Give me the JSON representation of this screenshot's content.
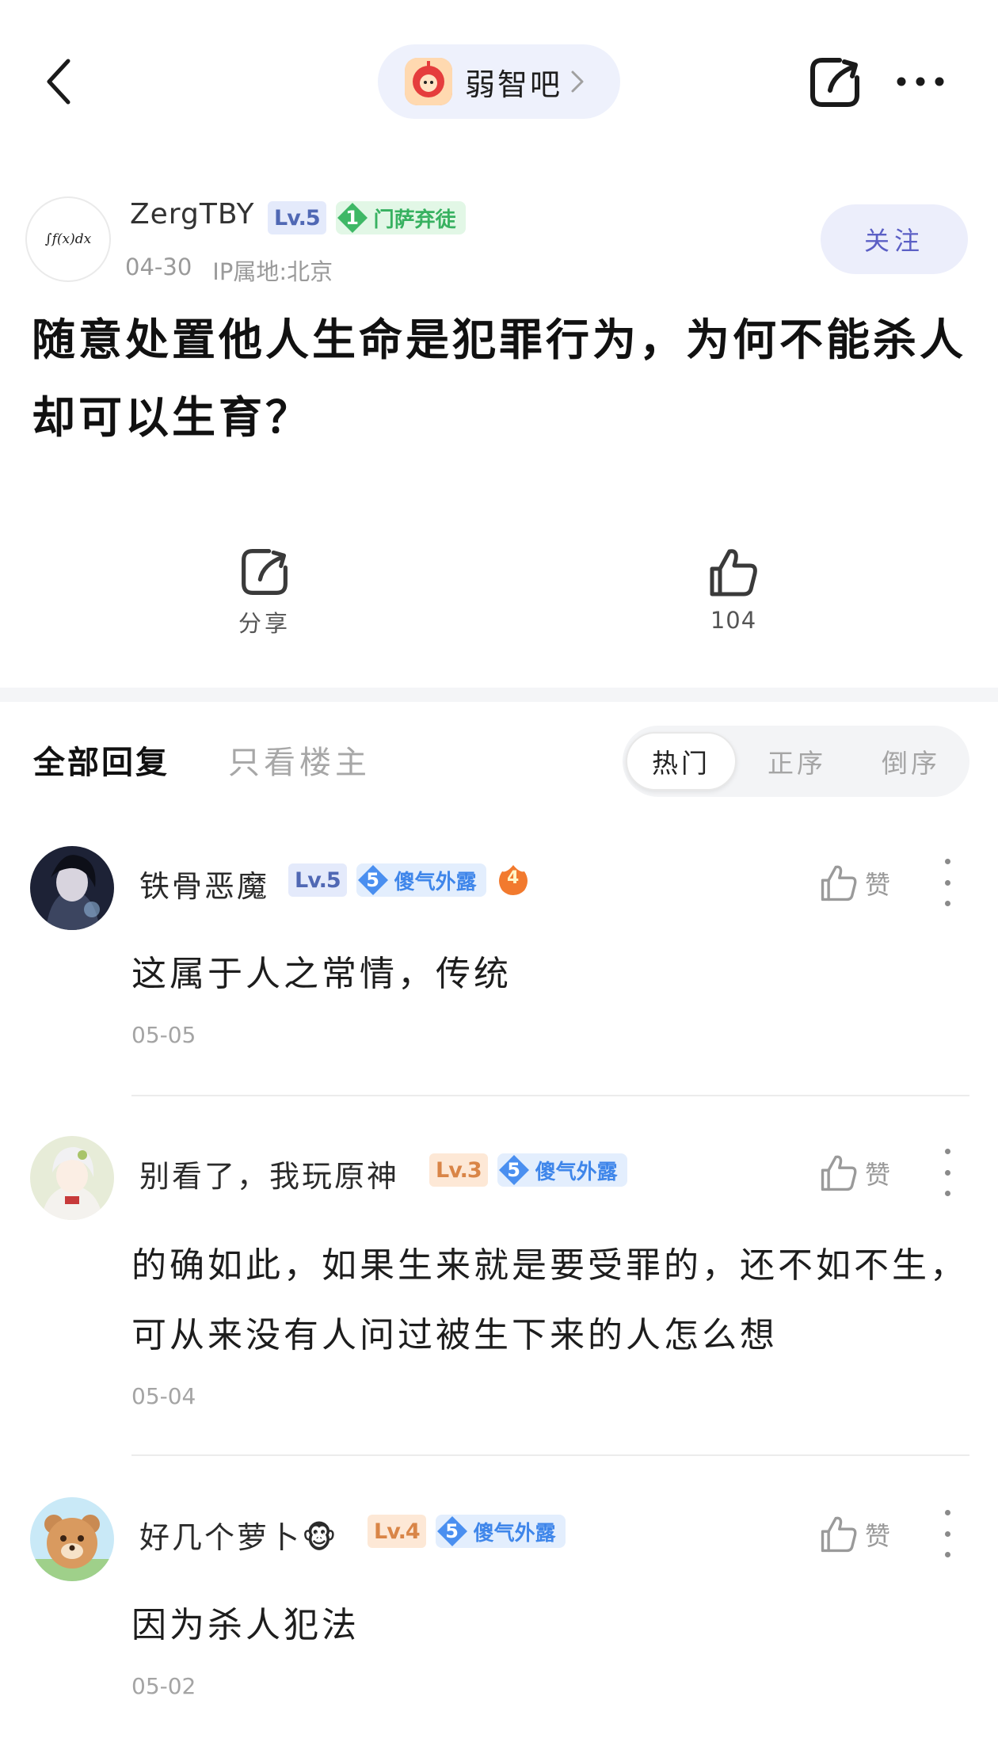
{
  "topbar": {
    "forum_name": "弱智吧"
  },
  "post": {
    "author": {
      "name": "ZergTBY",
      "avatar_formula": "∫f(x)dx",
      "level": "Lv.5",
      "title_rank": "1",
      "title_text": "门萨弃徒"
    },
    "date": "04-30",
    "ip_location": "IP属地:北京",
    "follow_label": "关注",
    "title": "随意处置他人生命是犯罪行为，为何不能杀人却可以生育？"
  },
  "actions": {
    "share_label": "分享",
    "like_count": "104"
  },
  "tabs": {
    "all_replies": "全部回复",
    "only_op": "只看楼主",
    "sort_options": [
      "热门",
      "正序",
      "倒序"
    ],
    "sort_active": "热门"
  },
  "comments": [
    {
      "username": "铁骨恶魔",
      "level": "Lv.5",
      "title_rank": "5",
      "title_text": "傻气外露",
      "extra_badge": "4",
      "text": "这属于人之常情，传统",
      "date": "05-05",
      "like_label": "赞"
    },
    {
      "username": "别看了，我玩原神",
      "level": "Lv.3",
      "title_rank": "5",
      "title_text": "傻气外露",
      "text": "的确如此，如果生来就是要受罪的，还不如不生，可从来没有人问过被生下来的人怎么想",
      "date": "05-04",
      "like_label": "赞"
    },
    {
      "username": "好几个萝卜",
      "username_emoji": "🐵",
      "level": "Lv.4",
      "title_rank": "5",
      "title_text": "傻气外露",
      "text": "因为杀人犯法",
      "date": "05-02",
      "like_label": "赞"
    }
  ]
}
